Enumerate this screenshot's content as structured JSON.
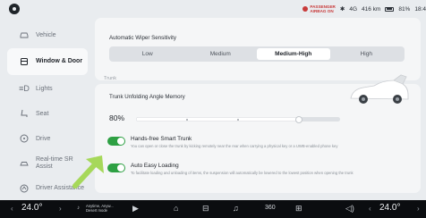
{
  "status": {
    "airbag_line1": "PASSENGER",
    "airbag_line2": "AIRBAG ON",
    "bluetooth": "✱",
    "signal": "4G",
    "range": "416 km",
    "battery": "81%",
    "time": "18:4"
  },
  "sidebar": {
    "items": [
      {
        "label": "Vehicle",
        "icon": "car-icon"
      },
      {
        "label": "Window & Door",
        "icon": "door-icon"
      },
      {
        "label": "Lights",
        "icon": "lights-icon"
      },
      {
        "label": "Seat",
        "icon": "seat-icon"
      },
      {
        "label": "Drive",
        "icon": "steering-wheel-icon"
      },
      {
        "label": "Real-time SR Assist",
        "icon": "assist-icon"
      },
      {
        "label": "Driver Assistance",
        "icon": "driver-assist-icon"
      }
    ]
  },
  "wiper": {
    "title": "Automatic Wiper Sensitivity",
    "options": [
      "Low",
      "Medium",
      "Medium-High",
      "High"
    ],
    "selected": "Medium-High"
  },
  "trunk": {
    "group_label": "Trunk",
    "angle_title": "Trunk Unfolding Angle Memory",
    "angle_value": "80%",
    "angle_percent": 80,
    "hands_free": {
      "title": "Hands-free Smart Trunk",
      "desc": "You can open or close the trunk by kicking remotely near the rear when carrying a physical key or a UWB-enabled phone key",
      "on": true
    },
    "easy_loading": {
      "title": "Auto Easy Loading",
      "desc": "To facilitate loading and unloading of items, the suspension will automatically be lowered to the lowest position when opening the trunk",
      "on": true
    }
  },
  "dock": {
    "left_temp": "24.0°",
    "right_temp": "24.0°",
    "media_title": "Anytime, Anyw...",
    "media_sub": "Desert mode",
    "label_360": "360"
  },
  "colors": {
    "toggle_on": "#2ea043",
    "arrow": "#a6d85a",
    "dock_bg": "#0b0d10"
  }
}
